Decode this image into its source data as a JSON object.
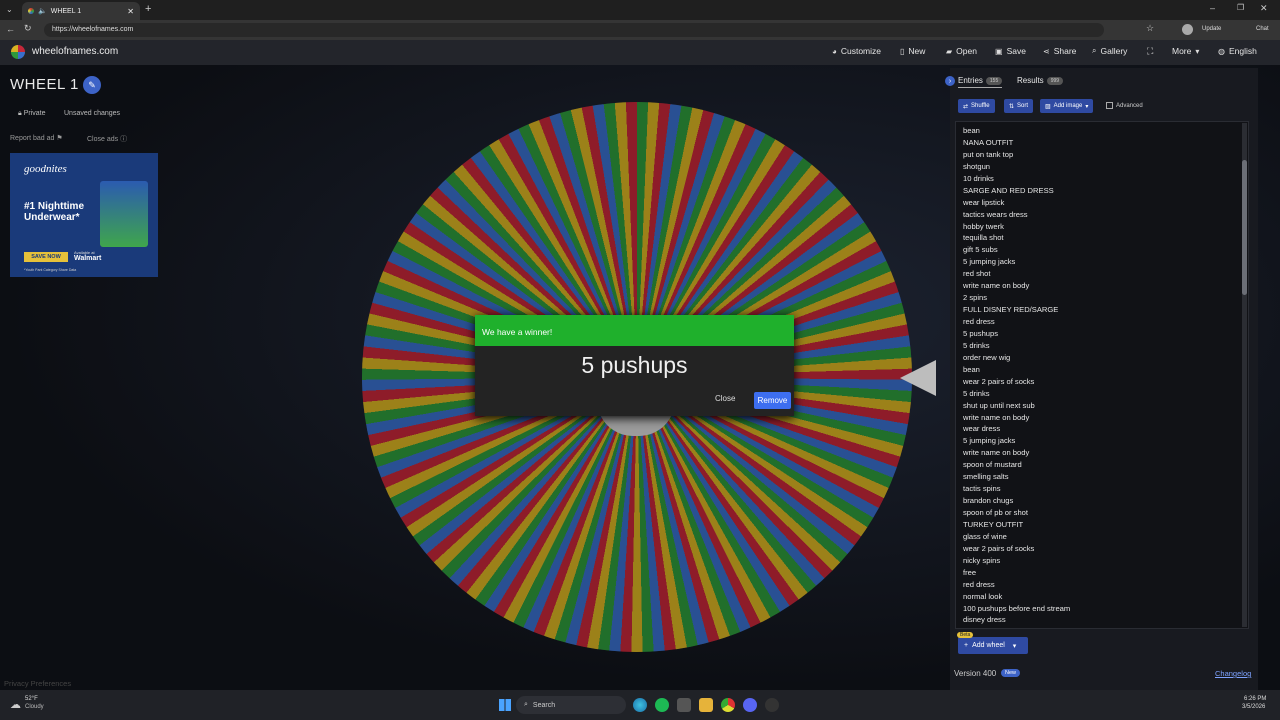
{
  "browser": {
    "tab_title": "WHEEL 1",
    "new_tab": "+",
    "url": "https://wheelofnames.com",
    "update_label": "Update",
    "chat_label": "Chat"
  },
  "nav": {
    "site_name": "wheelofnames.com",
    "customize": "Customize",
    "new": "New",
    "open": "Open",
    "save": "Save",
    "share": "Share",
    "gallery": "Gallery",
    "more": "More",
    "language": "English"
  },
  "wheel_header": {
    "title": "WHEEL 1",
    "private": "Private",
    "unsaved": "Unsaved changes",
    "report_ad": "Report bad ad",
    "close_ads": "Close ads"
  },
  "ad": {
    "brand": "goodnites",
    "headline": "#1 Nighttime Underwear*",
    "cta": "SAVE NOW",
    "retailer": "Walmart",
    "available": "Available at",
    "footnote": "*Youth Pant Category Share Data"
  },
  "popup": {
    "header": "We have a winner!",
    "winner": "5 pushups",
    "close": "Close",
    "remove": "Remove"
  },
  "panel": {
    "entries_tab": "Entries",
    "entries_count": "155",
    "results_tab": "Results",
    "results_count": "999",
    "shuffle": "Shuffle",
    "sort": "Sort",
    "add_image": "Add image",
    "advanced": "Advanced",
    "entries": [
      "bean",
      "NANA OUTFIT",
      "put on tank top",
      "shotgun",
      "10 drinks",
      "SARGE AND RED DRESS",
      "wear lipstick",
      "tactics wears dress",
      "hobby twerk",
      "tequilla shot",
      "gift 5 subs",
      "5 jumping jacks",
      "red shot",
      "write name on body",
      "2 spins",
      "FULL DISNEY RED/SARGE",
      "red dress",
      "5 pushups",
      "5 drinks",
      "order new wig",
      "bean",
      "wear 2 pairs of socks",
      "5 drinks",
      "shut up until next sub",
      "write name on body",
      "wear dress",
      "5 jumping jacks",
      "write name on body",
      "spoon of mustard",
      "smelling salts",
      "tactis spins",
      "brandon chugs",
      "spoon of pb or shot",
      "TURKEY OUTFIT",
      "glass of wine",
      "wear 2 pairs of socks",
      "nicky spins",
      "free",
      "red dress",
      "normal look",
      "100 pushups before end stream",
      "disney dress"
    ],
    "beta": "Beta",
    "add_wheel": "Add wheel",
    "version": "Version 400",
    "new_badge": "New",
    "changelog": "Changelog"
  },
  "footer": {
    "privacy": "Privacy Preferences"
  },
  "taskbar": {
    "weather_temp": "52°F",
    "weather_desc": "Cloudy",
    "search": "Search",
    "time": "6:26 PM",
    "date": "3/5/2026"
  },
  "colors": {
    "wheel_green": "#2e9a3c",
    "wheel_yellow": "#d8b323",
    "wheel_red": "#c5283a",
    "wheel_blue": "#3a6fcc",
    "popup_green": "#1fb02c",
    "accent_blue": "#3d6ef0"
  }
}
